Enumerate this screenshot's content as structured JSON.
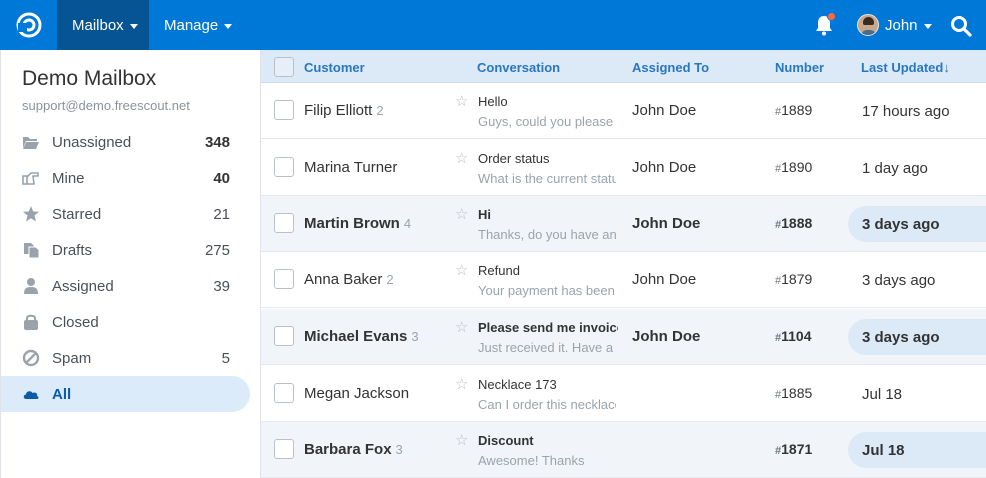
{
  "topbar": {
    "nav": [
      {
        "label": "Mailbox"
      },
      {
        "label": "Manage"
      }
    ],
    "user_name": "John"
  },
  "sidebar": {
    "mailbox_name": "Demo Mailbox",
    "mailbox_email": "support@demo.freescout.net",
    "folders": [
      {
        "label": "Unassigned",
        "count": "348",
        "icon": "folder-open-icon"
      },
      {
        "label": "Mine",
        "count": "40",
        "icon": "hand-point-icon"
      },
      {
        "label": "Starred",
        "count": "21",
        "icon": "star-icon"
      },
      {
        "label": "Drafts",
        "count": "275",
        "icon": "drafts-icon"
      },
      {
        "label": "Assigned",
        "count": "39",
        "icon": "user-icon"
      },
      {
        "label": "Closed",
        "count": "",
        "icon": "lock-icon"
      },
      {
        "label": "Spam",
        "count": "5",
        "icon": "ban-icon"
      },
      {
        "label": "All",
        "count": "",
        "icon": "cloud-icon"
      }
    ]
  },
  "table": {
    "headers": {
      "customer": "Customer",
      "conversation": "Conversation",
      "assigned": "Assigned To",
      "number": "Number",
      "updated": "Last Updated↓"
    },
    "rows": [
      {
        "customer": "Filip Elliott",
        "count": "2",
        "subject": "Hello",
        "preview": "Guys, could you please",
        "assigned": "John Doe",
        "number": "1889",
        "updated": "17 hours ago",
        "unread": false
      },
      {
        "customer": "Marina Turner",
        "count": "",
        "subject": "Order status",
        "preview": "What is the current status",
        "assigned": "John Doe",
        "number": "1890",
        "updated": "1 day ago",
        "unread": false
      },
      {
        "customer": "Martin Brown",
        "count": "4",
        "subject": "Hi",
        "preview": "Thanks, do you have any",
        "assigned": "John Doe",
        "number": "1888",
        "updated": "3 days ago",
        "unread": true
      },
      {
        "customer": "Anna Baker",
        "count": "2",
        "subject": "Refund",
        "preview": "Your payment has been",
        "assigned": "John Doe",
        "number": "1879",
        "updated": "3 days ago",
        "unread": false
      },
      {
        "customer": "Michael Evans",
        "count": "3",
        "subject": "Please send me invoice",
        "preview": "Just received it. Have a",
        "assigned": "John Doe",
        "number": "1104",
        "updated": "3 days ago",
        "unread": true
      },
      {
        "customer": "Megan Jackson",
        "count": "",
        "subject": "Necklace 173",
        "preview": "Can I order this necklace",
        "assigned": "",
        "number": "1885",
        "updated": "Jul 18",
        "unread": false
      },
      {
        "customer": "Barbara Fox",
        "count": "3",
        "subject": "Discount",
        "preview": "Awesome! Thanks",
        "assigned": "",
        "number": "1871",
        "updated": "Jul 18",
        "unread": true
      }
    ]
  }
}
